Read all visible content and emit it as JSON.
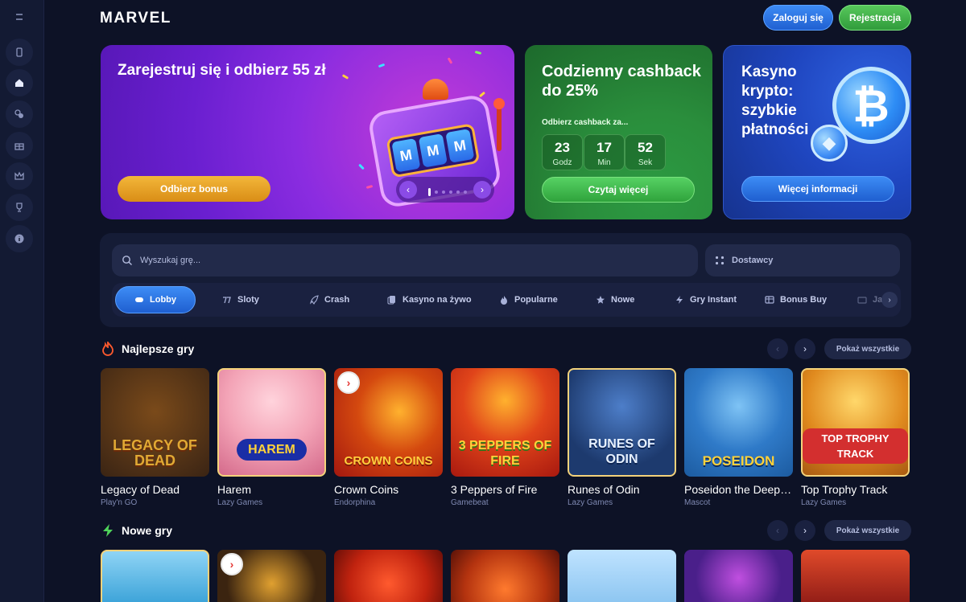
{
  "header": {
    "logo": "MARVEL",
    "login_label": "Zaloguj się",
    "register_label": "Rejestracja"
  },
  "sidebar": {
    "items": [
      {
        "icon": "menu-icon"
      },
      {
        "icon": "mobile-icon"
      },
      {
        "icon": "home-icon"
      },
      {
        "icon": "casino-chips-icon"
      },
      {
        "icon": "gift-icon"
      },
      {
        "icon": "crown-icon"
      },
      {
        "icon": "trophy-icon"
      },
      {
        "icon": "info-icon"
      }
    ]
  },
  "banners": {
    "bonus": {
      "title": "Zarejestruj się i odbierz 55 zł",
      "button": "Odbierz bonus",
      "reels": [
        "M",
        "M",
        "M"
      ]
    },
    "cashback": {
      "title": "Codzienny cashback do 25%",
      "subtitle": "Odbierz cashback za...",
      "timer": [
        {
          "value": "23",
          "label": "Godz"
        },
        {
          "value": "17",
          "label": "Min"
        },
        {
          "value": "52",
          "label": "Sek"
        }
      ],
      "button": "Czytaj więcej"
    },
    "crypto": {
      "title": "Kasyno krypto: szybkie płatności",
      "button": "Więcej informacji",
      "coin_symbol": "₿",
      "coin_small_symbol": "◆"
    }
  },
  "search": {
    "placeholder": "Wyszukaj grę...",
    "providers_label": "Dostawcy"
  },
  "categories": [
    {
      "label": "Lobby",
      "icon": "gamepad-icon",
      "active": true
    },
    {
      "label": "Sloty",
      "icon": "slots-icon"
    },
    {
      "label": "Crash",
      "icon": "rocket-icon"
    },
    {
      "label": "Kasyno na żywo",
      "icon": "live-cards-icon"
    },
    {
      "label": "Popularne",
      "icon": "fire-icon"
    },
    {
      "label": "Nowe",
      "icon": "star-icon"
    },
    {
      "label": "Gry Instant",
      "icon": "lightning-icon"
    },
    {
      "label": "Bonus Buy",
      "icon": "bonus-buy-icon"
    },
    {
      "label": "Ja",
      "icon": "jackpot-icon"
    }
  ],
  "sections": {
    "top": {
      "title": "Najlepsze gry",
      "show_all": "Pokaż wszystkie",
      "games": [
        {
          "name": "Legacy of Dead",
          "provider": "Play'n GO",
          "logo": "LEGACY OF DEAD",
          "bg": "#3a2414",
          "accent": "#e0a934"
        },
        {
          "name": "Harem",
          "provider": "Lazy Games",
          "logo": "HAREM",
          "bg": "#f3a3b6",
          "accent": "#1a2ea6"
        },
        {
          "name": "Crown Coins",
          "provider": "Endorphina",
          "logo": "CROWN COINS",
          "bg": "#a3170f",
          "accent": "#ffcf3d"
        },
        {
          "name": "3 Peppers of Fire",
          "provider": "Gamebeat",
          "logo": "3 PEPPERS OF FIRE",
          "bg": "#c2271a",
          "accent": "#ffd23a"
        },
        {
          "name": "Runes of Odin",
          "provider": "Lazy Games",
          "logo": "RUNES OF ODIN",
          "bg": "#1d3a6e",
          "accent": "#e6f0ff"
        },
        {
          "name": "Poseidon the Deep King",
          "provider": "Mascot",
          "logo": "POSEIDON",
          "bg": "#1c5ba0",
          "accent": "#ffd23a"
        },
        {
          "name": "Top Trophy Track",
          "provider": "Lazy Games",
          "logo": "TOP TROPHY TRACK",
          "bg": "#e08a1e",
          "accent": "#ffffff"
        }
      ]
    },
    "new": {
      "title": "Nowe gry",
      "show_all": "Pokaż wszystkie",
      "games": [
        {
          "bg": "#3aa2d8"
        },
        {
          "bg": "#3b2410"
        },
        {
          "bg": "#c1230f"
        },
        {
          "bg": "#b4330f"
        },
        {
          "bg": "#8ac4f0"
        },
        {
          "bg": "#4a1f8a"
        },
        {
          "bg": "#8e1b16"
        }
      ]
    }
  }
}
